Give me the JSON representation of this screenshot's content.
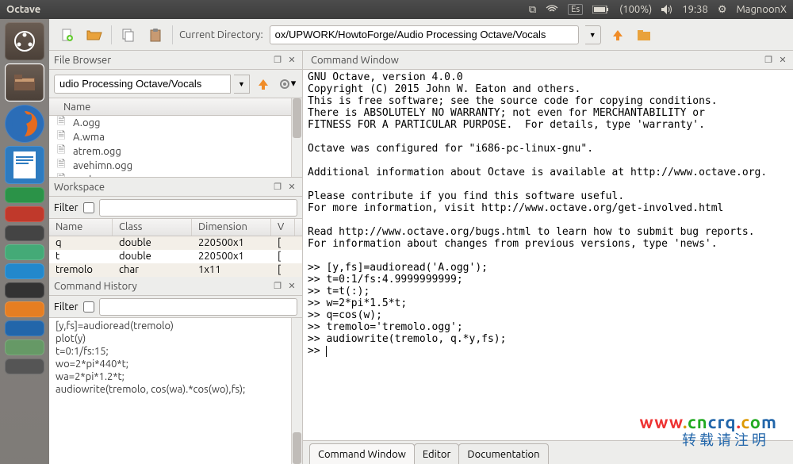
{
  "topbar": {
    "app_name": "Octave",
    "lang": "Es",
    "battery": "(100%)",
    "time": "19:38",
    "user": "MagnoonX"
  },
  "toolbar": {
    "cd_label": "Current Directory:",
    "cd_value": "ox/UPWORK/HowtoForge/Audio Processing Octave/Vocals"
  },
  "file_browser": {
    "title": "File Browser",
    "path": "udio Processing Octave/Vocals",
    "name_header": "Name",
    "files": [
      "A.ogg",
      "A.wma",
      "atrem.ogg",
      "avehimn.ogg",
      "avehymnus.ogg"
    ]
  },
  "workspace": {
    "title": "Workspace",
    "filter_label": "Filter",
    "headers": {
      "name": "Name",
      "class": "Class",
      "dim": "Dimension",
      "v": "V"
    },
    "rows": [
      {
        "name": "q",
        "class": "double",
        "dim": "220500x1",
        "v": "["
      },
      {
        "name": "t",
        "class": "double",
        "dim": "220500x1",
        "v": "["
      },
      {
        "name": "tremolo",
        "class": "char",
        "dim": "1x11",
        "v": "["
      }
    ]
  },
  "command_history": {
    "title": "Command History",
    "filter_label": "Filter",
    "items": [
      "[y,fs]=audioread(tremolo)",
      "plot(y)",
      "t=0:1/fs:15;",
      "wo=2*pi*440*t;",
      "wa=2*pi*1.2*t;",
      "audiowrite(tremolo, cos(wa).*cos(wo),fs);"
    ]
  },
  "command_window": {
    "title": "Command Window",
    "text": "GNU Octave, version 4.0.0\nCopyright (C) 2015 John W. Eaton and others.\nThis is free software; see the source code for copying conditions.\nThere is ABSOLUTELY NO WARRANTY; not even for MERCHANTABILITY or\nFITNESS FOR A PARTICULAR PURPOSE.  For details, type 'warranty'.\n\nOctave was configured for \"i686-pc-linux-gnu\".\n\nAdditional information about Octave is available at http://www.octave.org.\n\nPlease contribute if you find this software useful.\nFor more information, visit http://www.octave.org/get-involved.html\n\nRead http://www.octave.org/bugs.html to learn how to submit bug reports.\nFor information about changes from previous versions, type 'news'.\n\n>> [y,fs]=audioread('A.ogg');\n>> t=0:1/fs:4.9999999999;\n>> t=t(:);\n>> w=2*pi*1.5*t;\n>> q=cos(w);\n>> tremolo='tremolo.ogg';\n>> audiowrite(tremolo, q.*y,fs);\n>> "
  },
  "tabs": {
    "cmd": "Command Window",
    "editor": "Editor",
    "doc": "Documentation"
  }
}
